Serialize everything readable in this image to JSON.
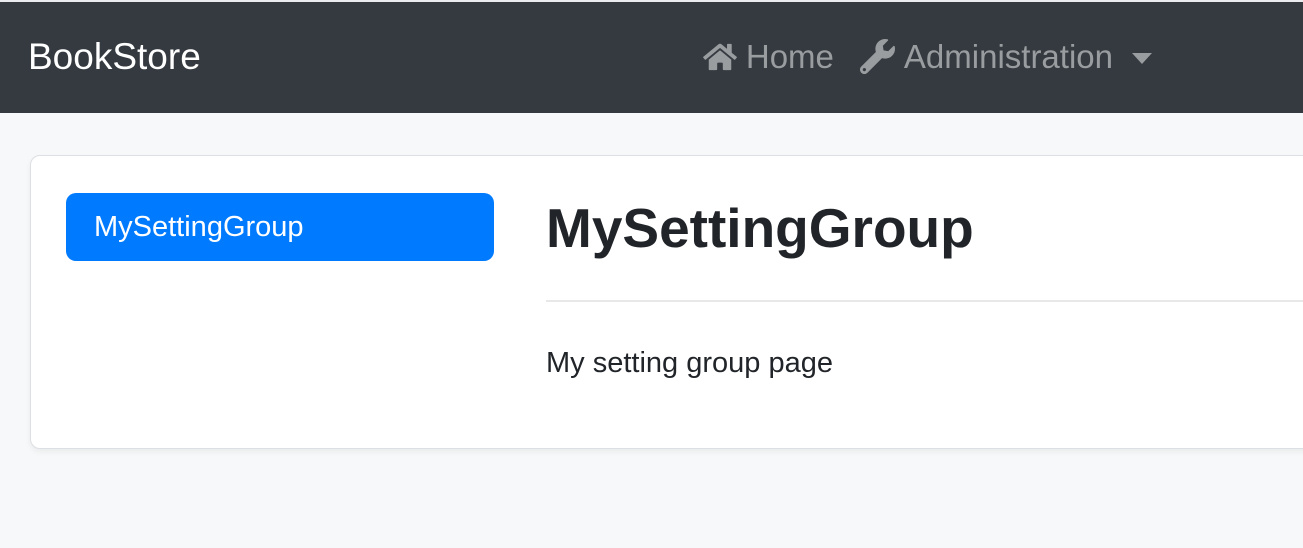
{
  "navbar": {
    "brand": "BookStore",
    "items": [
      {
        "label": "Home",
        "icon": "home-icon",
        "has_dropdown": false
      },
      {
        "label": "Administration",
        "icon": "wrench-icon",
        "has_dropdown": true
      }
    ]
  },
  "settings_page": {
    "active_tab": "MySettingGroup",
    "heading": "MySettingGroup",
    "body_text": "My setting group page"
  },
  "colors": {
    "navbar_bg": "#343a40",
    "primary": "#007bff",
    "page_bg": "#f6f8f9",
    "text": "#212529",
    "nav_link": "#9a9da0",
    "card_border": "#dcdfe3",
    "divider": "#e8e8e8"
  }
}
